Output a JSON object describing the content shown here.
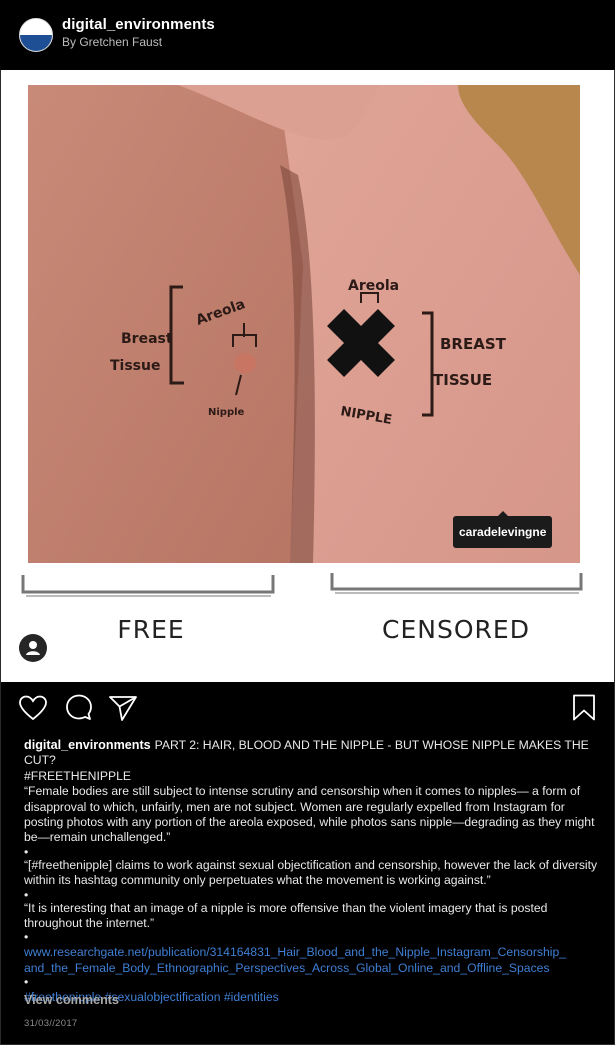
{
  "header": {
    "username": "digital_environments",
    "byline": "By Gretchen Faust"
  },
  "image": {
    "tagged_user": "caradelevingne",
    "label_left": "FREE",
    "label_right": "CENSORED",
    "annotations": {
      "left_breast_tissue_1": "Breast",
      "left_breast_tissue_2": "Tissue",
      "left_areola": "Areola",
      "left_nipple": "Nipple",
      "right_areola": "Areola",
      "right_nipple": "NIPPLE",
      "right_breast_1": "BREAST",
      "right_breast_2": "TISSUE"
    }
  },
  "actions": {
    "like_icon": "heart-outline",
    "comment_icon": "speech-bubble",
    "share_icon": "paper-plane",
    "save_icon": "bookmark-outline"
  },
  "post": {
    "username": "digital_environments",
    "title": "PART 2: HAIR, BLOOD AND THE NIPPLE - BUT WHOSE NIPPLE MAKES THE CUT?",
    "hashtag_line": "#FREETHENIPPLE",
    "quote1": "“Female bodies are still subject to intense scrutiny and censorship when it comes to nipples— a form of disapproval to which, unfairly, men are not subject. Women are regularly expelled from Instagram for posting photos with any portion of the areola exposed, while photos sans nipple—degrading as they might be—remain unchallenged.”",
    "bullet": "•",
    "quote2": "“[#freethenipple] claims to work against sexual objectification and censorship, however the lack of diversity within its hashtag community only perpetuates what the movement is working against.”",
    "quote3": "“It is interesting that an image of a nipple is more offensive than the violent imagery that is posted throughout the internet.”",
    "link_line1": "www.researchgate.net/publication/314164831_Hair_Blood_and_the_Nipple_Instagram_Censorship_",
    "link_line2": "and_the_Female_Body_Ethnographic_Perspectives_Across_Global_Online_and_Offline_Spaces",
    "tags": "#freethenipple #sexualobjectification #identities",
    "view_comments": "View  comments",
    "date": "31/03//2017"
  }
}
